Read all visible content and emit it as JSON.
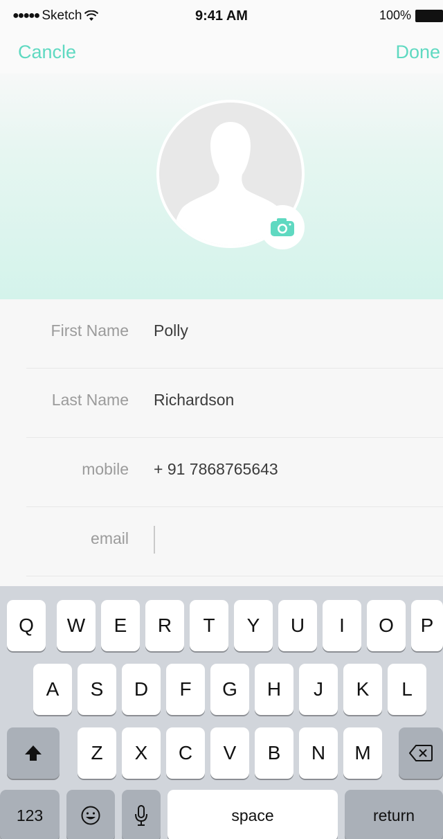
{
  "status_bar": {
    "signal": "●●●●●",
    "carrier": "Sketch",
    "time": "9:41 AM",
    "battery_percent": "100%"
  },
  "nav": {
    "cancel_label": "Cancle",
    "done_label": "Done"
  },
  "profile": {
    "avatar_icon": "person-silhouette-icon",
    "camera_icon": "camera-icon"
  },
  "form": {
    "fields": [
      {
        "label": "First Name",
        "value": "Polly"
      },
      {
        "label": "Last Name",
        "value": "Richardson"
      },
      {
        "label": "mobile",
        "value": "+ 91 7868765643"
      },
      {
        "label": "email",
        "value": ""
      }
    ]
  },
  "keyboard": {
    "row1": [
      "Q",
      "W",
      "E",
      "R",
      "T",
      "Y",
      "U",
      "I",
      "O",
      "P"
    ],
    "row2": [
      "A",
      "S",
      "D",
      "F",
      "G",
      "H",
      "J",
      "K",
      "L"
    ],
    "row3": [
      "Z",
      "X",
      "C",
      "V",
      "B",
      "N",
      "M"
    ],
    "numbers_label": "123",
    "space_label": "space",
    "return_label": "return",
    "shift_icon": "shift-icon",
    "backspace_icon": "backspace-icon",
    "emoji_icon": "emoji-icon",
    "mic_icon": "microphone-icon"
  },
  "colors": {
    "accent": "#5fd9c1",
    "hero_gradient_end": "#d4f3eb",
    "keyboard_bg": "#d1d5db"
  }
}
